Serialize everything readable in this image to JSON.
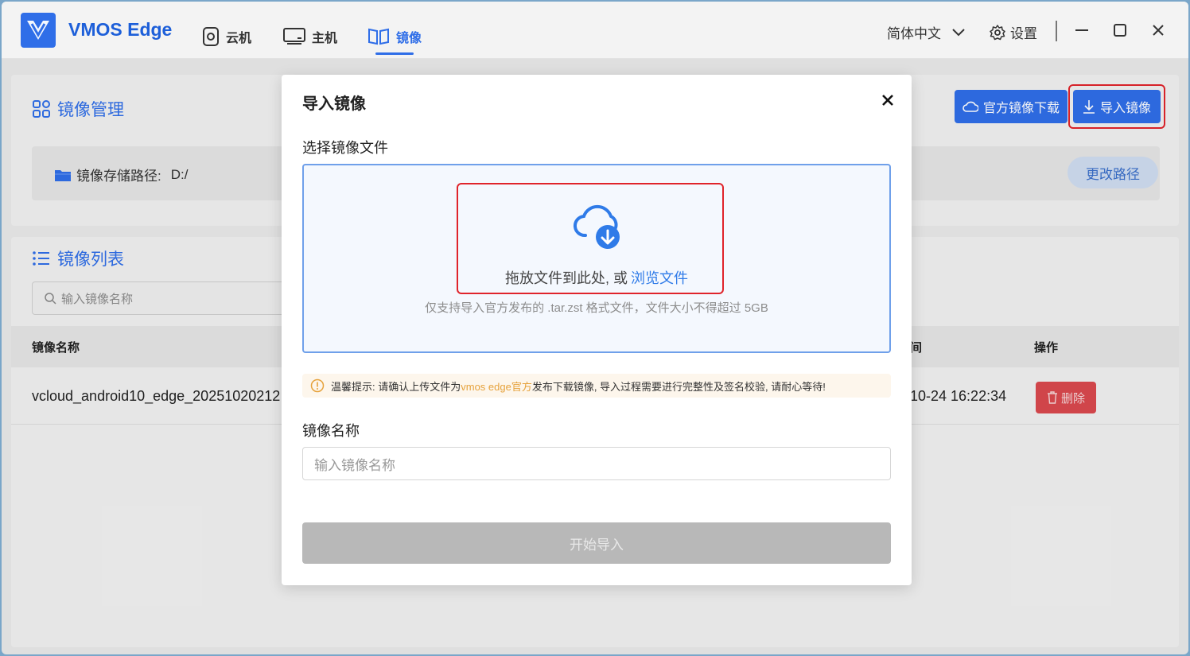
{
  "app": {
    "name": "VMOS Edge"
  },
  "nav": {
    "items": [
      {
        "label": "云机",
        "icon": "cloud-phone-icon"
      },
      {
        "label": "主机",
        "icon": "host-monitor-icon"
      },
      {
        "label": "镜像",
        "icon": "mirror-book-icon",
        "active": true
      }
    ]
  },
  "titlebar": {
    "language": "简体中文",
    "settings": "设置"
  },
  "image_management": {
    "title": "镜像管理",
    "storage_label": "镜像存储路径:",
    "storage_value": "D:/",
    "change_path": "更改路径",
    "official_download": "官方镜像下载",
    "import_button": "导入镜像"
  },
  "image_list": {
    "title": "镜像列表",
    "search_placeholder": "输入镜像名称",
    "columns": [
      "镜像名称",
      "间",
      "操作"
    ],
    "rows": [
      {
        "name": "vcloud_android10_edge_20251020212",
        "time": "10-24 16:22:34",
        "action": "删除"
      }
    ]
  },
  "modal": {
    "title": "导入镜像",
    "file_label": "选择镜像文件",
    "drop_text": "拖放文件到此处, 或",
    "browse": "浏览文件",
    "hint": "仅支持导入官方发布的 .tar.zst 格式文件，文件大小不得超过 5GB",
    "notice_prefix": "温馨提示: 请确认上传文件为",
    "notice_highlight": "vmos edge官方",
    "notice_suffix": "发布下载镜像, 导入过程需要进行完整性及签名校验, 请耐心等待!",
    "name_label": "镜像名称",
    "name_placeholder": "输入镜像名称",
    "start_button": "开始导入"
  },
  "colors": {
    "accent": "#2f6ee8",
    "danger": "#d9484e",
    "warning": "#e6a23c",
    "highlight_border": "#e0242b"
  }
}
